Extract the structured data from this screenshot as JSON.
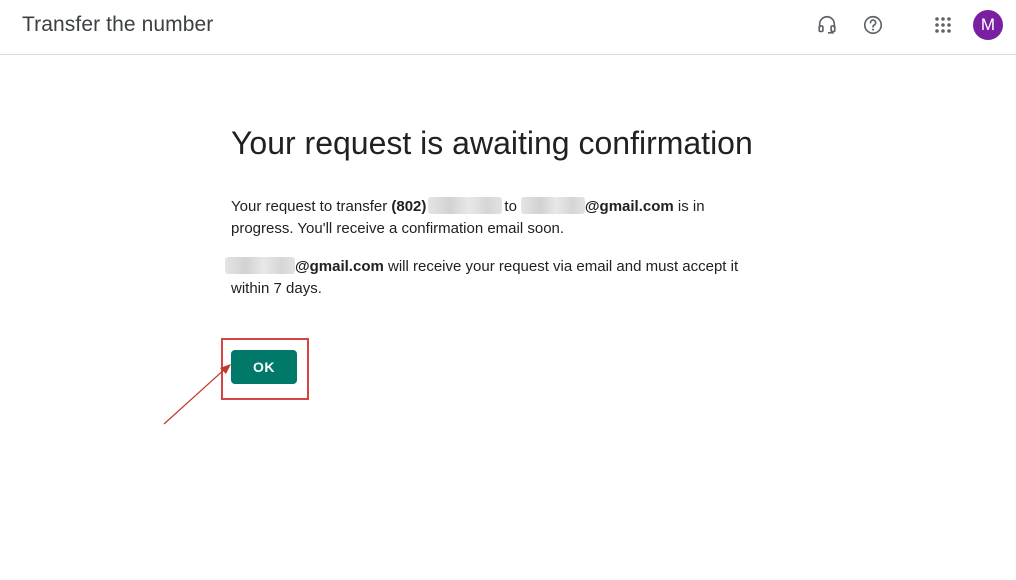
{
  "header": {
    "title": "Transfer the number",
    "support_icon": "headset-icon",
    "help_icon": "help-circle-icon",
    "apps_icon": "apps-grid-icon",
    "avatar_initial": "M",
    "avatar_color": "#7b1fa2"
  },
  "main": {
    "heading": "Your request is awaiting confirmation",
    "paragraph1": {
      "prefix": "Your request to transfer ",
      "number_area": "(802)",
      "to_text": "to",
      "email_domain": "@gmail.com",
      "suffix": " is in progress. You'll receive a confirmation email soon."
    },
    "paragraph2": {
      "email_domain": "@gmail.com",
      "suffix": " will receive your request via email and must accept it within 7 days."
    },
    "ok_button_label": "OK"
  },
  "colors": {
    "accent": "#00796b",
    "highlight": "#d84343",
    "divider": "#dadce0"
  }
}
